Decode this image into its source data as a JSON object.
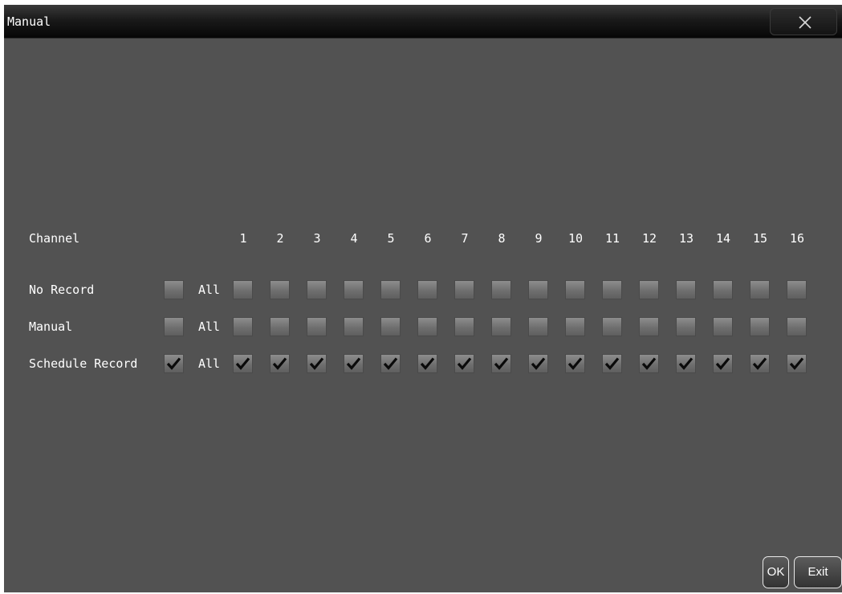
{
  "window": {
    "title": "Manual",
    "close_label": "×"
  },
  "grid": {
    "channel_header": "Channel",
    "all_label": "All",
    "channels": [
      "1",
      "2",
      "3",
      "4",
      "5",
      "6",
      "7",
      "8",
      "9",
      "10",
      "11",
      "12",
      "13",
      "14",
      "15",
      "16"
    ],
    "rows": [
      {
        "label": "No Record",
        "all_checked": false,
        "checked": [
          false,
          false,
          false,
          false,
          false,
          false,
          false,
          false,
          false,
          false,
          false,
          false,
          false,
          false,
          false,
          false
        ]
      },
      {
        "label": "Manual",
        "all_checked": false,
        "checked": [
          false,
          false,
          false,
          false,
          false,
          false,
          false,
          false,
          false,
          false,
          false,
          false,
          false,
          false,
          false,
          false
        ]
      },
      {
        "label": "Schedule Record",
        "all_checked": true,
        "checked": [
          true,
          true,
          true,
          true,
          true,
          true,
          true,
          true,
          true,
          true,
          true,
          true,
          true,
          true,
          true,
          true
        ]
      }
    ]
  },
  "buttons": {
    "ok": "OK",
    "exit": "Exit"
  },
  "icons": {
    "close": "close-icon",
    "check": "checkmark-icon"
  }
}
